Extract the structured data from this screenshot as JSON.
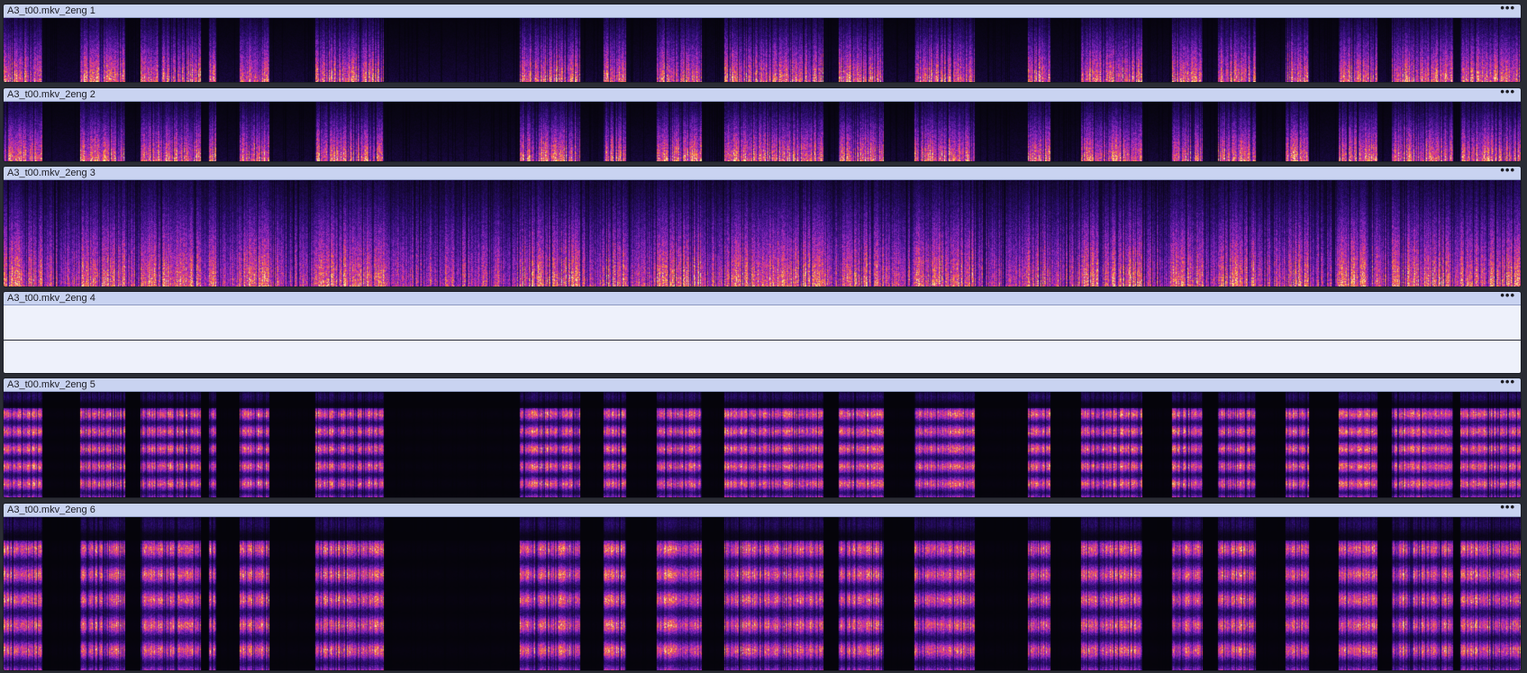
{
  "tracks": [
    {
      "name": "A3_t00.mkv_2eng 1",
      "menu": "•••",
      "view": "spectrogram",
      "profile": "broadband"
    },
    {
      "name": "A3_t00.mkv_2eng 2",
      "menu": "•••",
      "view": "spectrogram",
      "profile": "broadband"
    },
    {
      "name": "A3_t00.mkv_2eng 3",
      "menu": "•••",
      "view": "spectrogram",
      "profile": "dense"
    },
    {
      "name": "A3_t00.mkv_2eng 4",
      "menu": "•••",
      "view": "silent",
      "profile": "none"
    },
    {
      "name": "A3_t00.mkv_2eng 5",
      "menu": "•••",
      "view": "spectrogram",
      "profile": "banded"
    },
    {
      "name": "A3_t00.mkv_2eng 6",
      "menu": "•••",
      "view": "spectrogram",
      "profile": "banded"
    }
  ],
  "colors": {
    "header_bg": "#c9d3f1",
    "spectrogram_bg": "#05040a",
    "silent_bg": "#eef1fb",
    "palette": [
      "#05040a",
      "#2a0d6e",
      "#6a1fb0",
      "#b32fb8",
      "#e8446f",
      "#f7923a",
      "#fbe09a"
    ]
  }
}
